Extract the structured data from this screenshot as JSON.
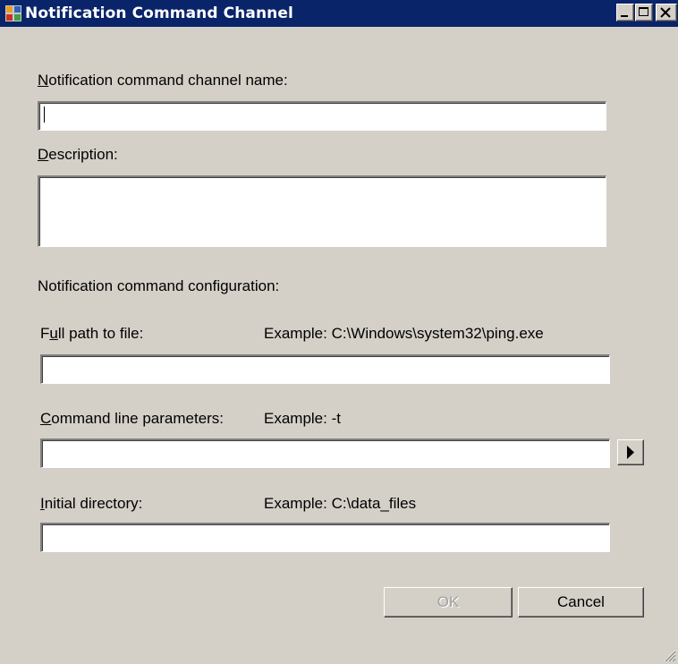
{
  "window": {
    "title": "Notification Command Channel",
    "controls": {
      "minimize": "minimize-icon",
      "maximize": "maximize-icon",
      "close": "close-icon"
    }
  },
  "form": {
    "name_label_mnemonic": "N",
    "name_label_rest": "otification command channel name:",
    "name_value": "",
    "description_label_mnemonic": "D",
    "description_label_rest": "escription:",
    "description_value": "",
    "config_heading": "Notification command configuration:",
    "path_label_pre": "F",
    "path_label_mnemonic": "u",
    "path_label_rest": "ll path to file:",
    "path_example": "Example: C:\\Windows\\system32\\ping.exe",
    "path_value": "",
    "params_label_mnemonic": "C",
    "params_label_rest": "ommand line parameters:",
    "params_example": "Example: -t",
    "params_value": "",
    "params_menu_icon": "right-arrow-icon",
    "dir_label_mnemonic": "I",
    "dir_label_rest": "nitial directory:",
    "dir_example": "Example: C:\\data_files",
    "dir_value": ""
  },
  "buttons": {
    "ok": "OK",
    "cancel": "Cancel"
  },
  "colors": {
    "titlebar": "#0a246a",
    "dialog_bg": "#d4d0c8",
    "disabled_text": "#a0a0a0"
  }
}
